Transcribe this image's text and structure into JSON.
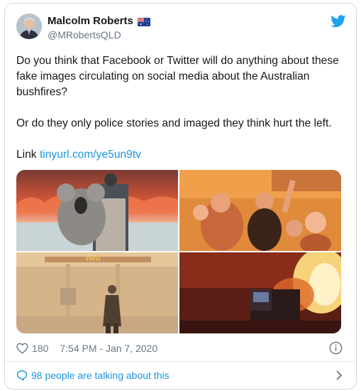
{
  "tweet": {
    "author": {
      "display_name": "Malcolm Roberts",
      "handle": "@MRobertsQLD",
      "badge": "australian-flag-icon"
    },
    "text": {
      "paragraph_1": "Do you think that Facebook or Twitter will do anything about these fake images circulating on social media about the Australian bushfires?",
      "paragraph_2": "Or do they only police stories and imaged they think hurt the left.",
      "link_prefix": "Link",
      "link_text": "tinyurl.com/ye5un9tv"
    },
    "media_overlay_text": "hell",
    "meta": {
      "like_count": "180",
      "timestamp": "7:54 PM - Jan 7, 2020"
    },
    "footer": {
      "conversation_label": "98 people are talking about this"
    }
  },
  "colors": {
    "accent": "#1b95e0",
    "twitter_blue": "#1da1f2",
    "text": "#14171a",
    "secondary_text": "#657786",
    "border": "#cfd9de"
  }
}
